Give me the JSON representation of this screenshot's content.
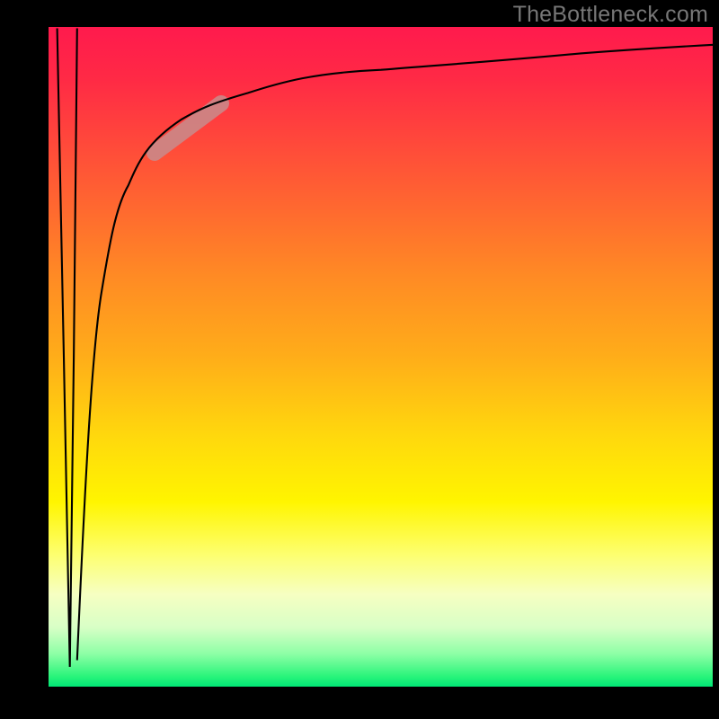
{
  "watermark": "TheBottleneck.com",
  "chart_data": {
    "type": "line",
    "title": "",
    "xlabel": "",
    "ylabel": "",
    "xlim": [
      0,
      100
    ],
    "ylim": [
      0,
      100
    ],
    "grid": false,
    "legend": null,
    "series": [
      {
        "name": "dip",
        "x": [
          1.3,
          2.3,
          3.2,
          3.8,
          4.3
        ],
        "values": [
          99.8,
          50.0,
          3.0,
          50.0,
          99.8
        ]
      },
      {
        "name": "main-curve",
        "x": [
          4.3,
          6,
          8,
          10,
          12,
          15,
          20,
          25,
          30,
          40,
          50,
          60,
          70,
          80,
          90,
          100
        ],
        "values": [
          4.0,
          40,
          60,
          70,
          76,
          81,
          86,
          88.5,
          90,
          92.5,
          94,
          95,
          95.8,
          96.4,
          96.9,
          97.3
        ]
      }
    ],
    "highlight_segment": {
      "series": "main-curve",
      "x_range": [
        16,
        26
      ],
      "color": "#c98a8a"
    },
    "background_gradient": {
      "orientation": "vertical",
      "stops": [
        {
          "pos": 0.0,
          "color": "#ff1a4d"
        },
        {
          "pos": 0.5,
          "color": "#ffad19"
        },
        {
          "pos": 0.72,
          "color": "#fff500"
        },
        {
          "pos": 1.0,
          "color": "#00e676"
        }
      ]
    }
  }
}
